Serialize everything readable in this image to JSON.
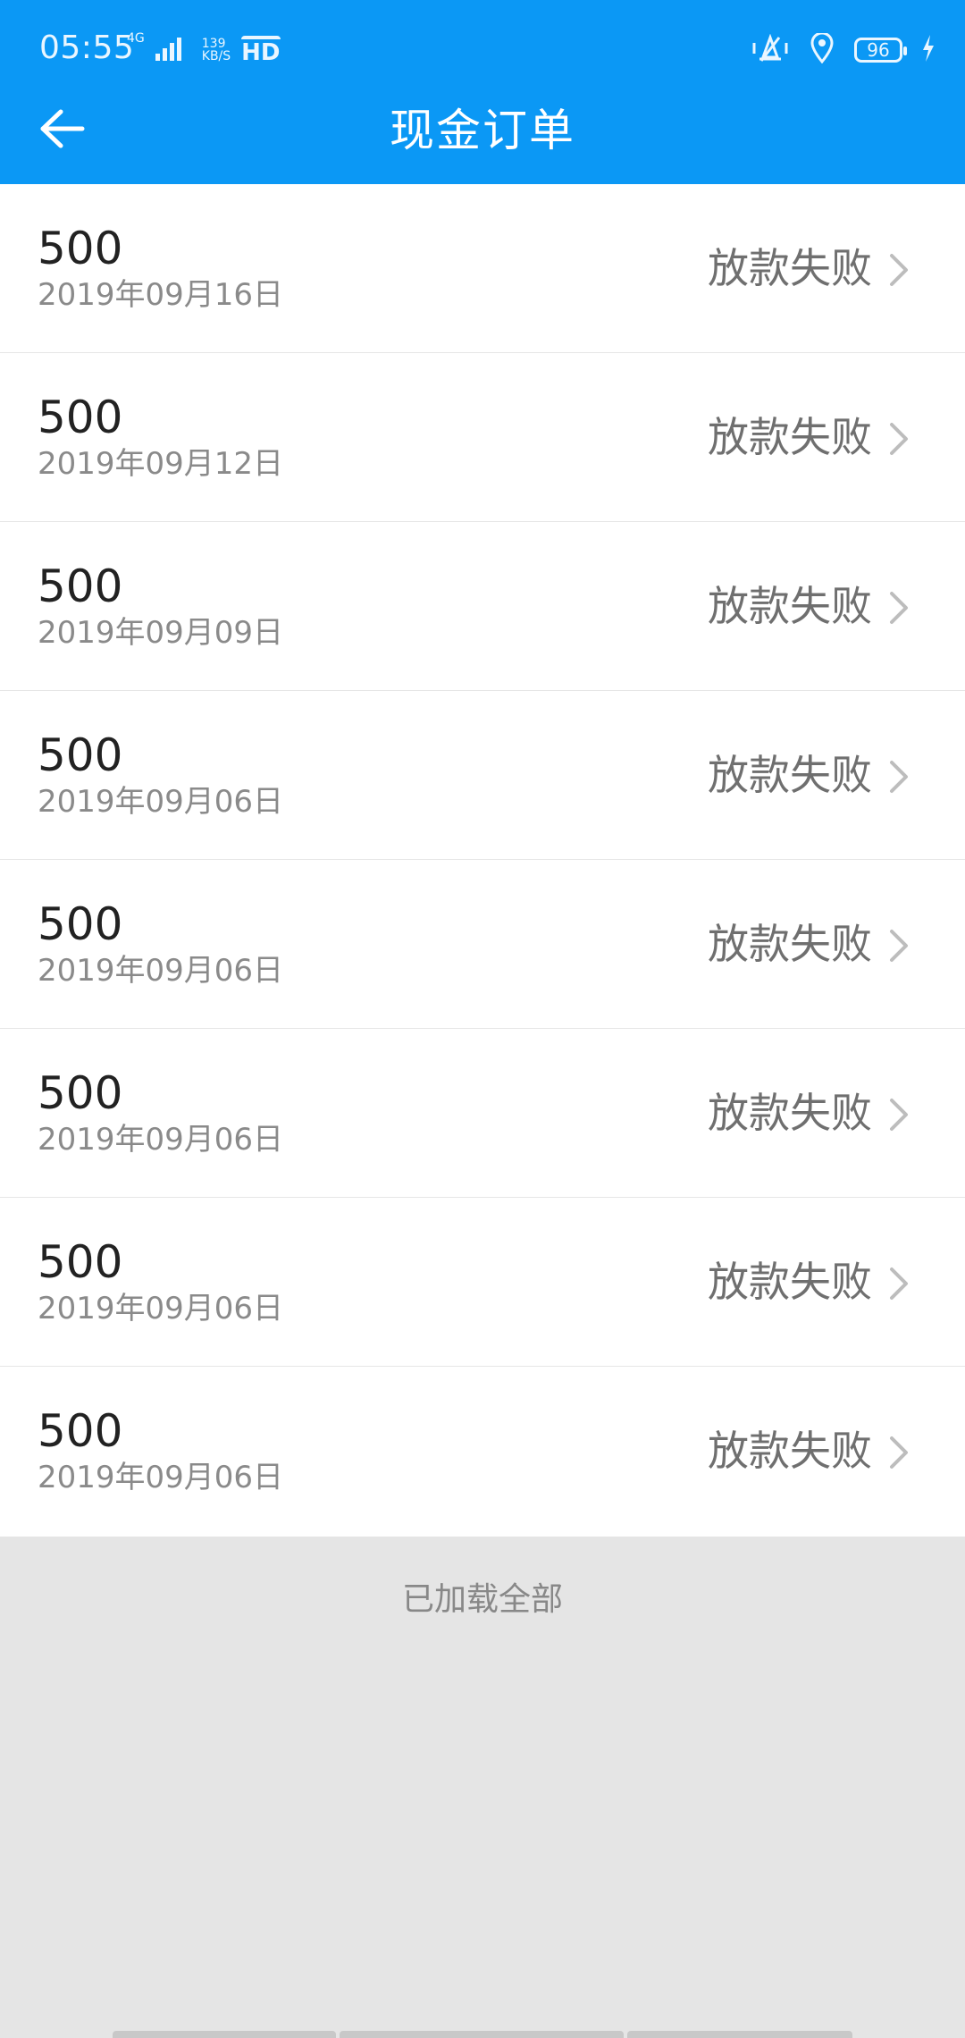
{
  "status_bar": {
    "time": "05:55",
    "network": "4G",
    "speed_value": "139",
    "speed_unit": "KB/S",
    "hd": "HD",
    "battery": "96"
  },
  "header": {
    "title": "现金订单"
  },
  "orders": [
    {
      "amount": "500",
      "date": "2019年09月16日",
      "status": "放款失败"
    },
    {
      "amount": "500",
      "date": "2019年09月12日",
      "status": "放款失败"
    },
    {
      "amount": "500",
      "date": "2019年09月09日",
      "status": "放款失败"
    },
    {
      "amount": "500",
      "date": "2019年09月06日",
      "status": "放款失败"
    },
    {
      "amount": "500",
      "date": "2019年09月06日",
      "status": "放款失败"
    },
    {
      "amount": "500",
      "date": "2019年09月06日",
      "status": "放款失败"
    },
    {
      "amount": "500",
      "date": "2019年09月06日",
      "status": "放款失败"
    },
    {
      "amount": "500",
      "date": "2019年09月06日",
      "status": "放款失败"
    }
  ],
  "footer": {
    "loaded_all": "已加载全部"
  },
  "colors": {
    "header_bg": "#0b98f5",
    "page_bg": "#e5e5e5",
    "amount_text": "#222222",
    "date_text": "#8a8a8a",
    "status_text": "#6f6f6f"
  },
  "icons": {
    "back": "arrow-left-icon",
    "chevron": "chevron-right-icon",
    "signal": "signal-icon",
    "vibrate": "vibrate-icon",
    "location": "location-icon",
    "battery": "battery-icon",
    "charging": "charging-icon"
  }
}
